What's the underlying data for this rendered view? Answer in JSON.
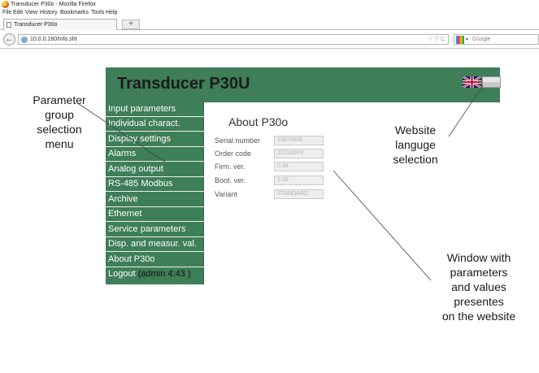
{
  "browser": {
    "window_title": "Transducer P30o - Mozilla Firefox",
    "menu": [
      "File",
      "Edit",
      "View",
      "History",
      "Bookmarks",
      "Tools",
      "Help"
    ],
    "tab_label": "Transducer P30o",
    "new_tab_label": "+",
    "url": "10.0.0.180/info.sht",
    "search_placeholder": "Google",
    "back_glyph": "←",
    "url_end_icons": "☆ ▽ C"
  },
  "page": {
    "title": "Transducer P30U",
    "languages": [
      "English",
      "Polish"
    ],
    "menu_items": [
      "Input parameters",
      "Individual charact.",
      "Display settings",
      "Alarms",
      "Analog output",
      "RS-485 Modbus",
      "Archive",
      "Ethernet",
      "Service parameters",
      "Disp. and measur. val.",
      "About P30o"
    ],
    "logout_label": "Logout",
    "logout_user": "(admin 4:43 )",
    "section_title": "About P30o",
    "fields": [
      {
        "label": "Serial number",
        "value": "13070005"
      },
      {
        "label": "Order code",
        "value": "222100PX"
      },
      {
        "label": "Firm. ver.",
        "value": "0.38"
      },
      {
        "label": "Boot. ver.",
        "value": "2.00"
      },
      {
        "label": "Variant",
        "value": "STANDARD"
      }
    ]
  },
  "annotations": {
    "menu_note": [
      "Parameter",
      "group",
      "selection",
      "menu"
    ],
    "language_note": [
      "Website",
      "languge",
      "selection"
    ],
    "window_note": [
      "Window with",
      "parameters",
      "and values",
      "presentes",
      "on the website"
    ]
  },
  "colors": {
    "panel_green": "#3e7e58",
    "header_text": "#1c1c1c",
    "menu_text": "#ffffff"
  },
  "icons": {
    "browser": "firefox-icon",
    "back": "back-arrow-icon",
    "site": "site-identity-icon",
    "search_engine": "google-icon",
    "uk_flag": "uk-flag-icon",
    "pl_flag": "polish-flag-icon"
  }
}
